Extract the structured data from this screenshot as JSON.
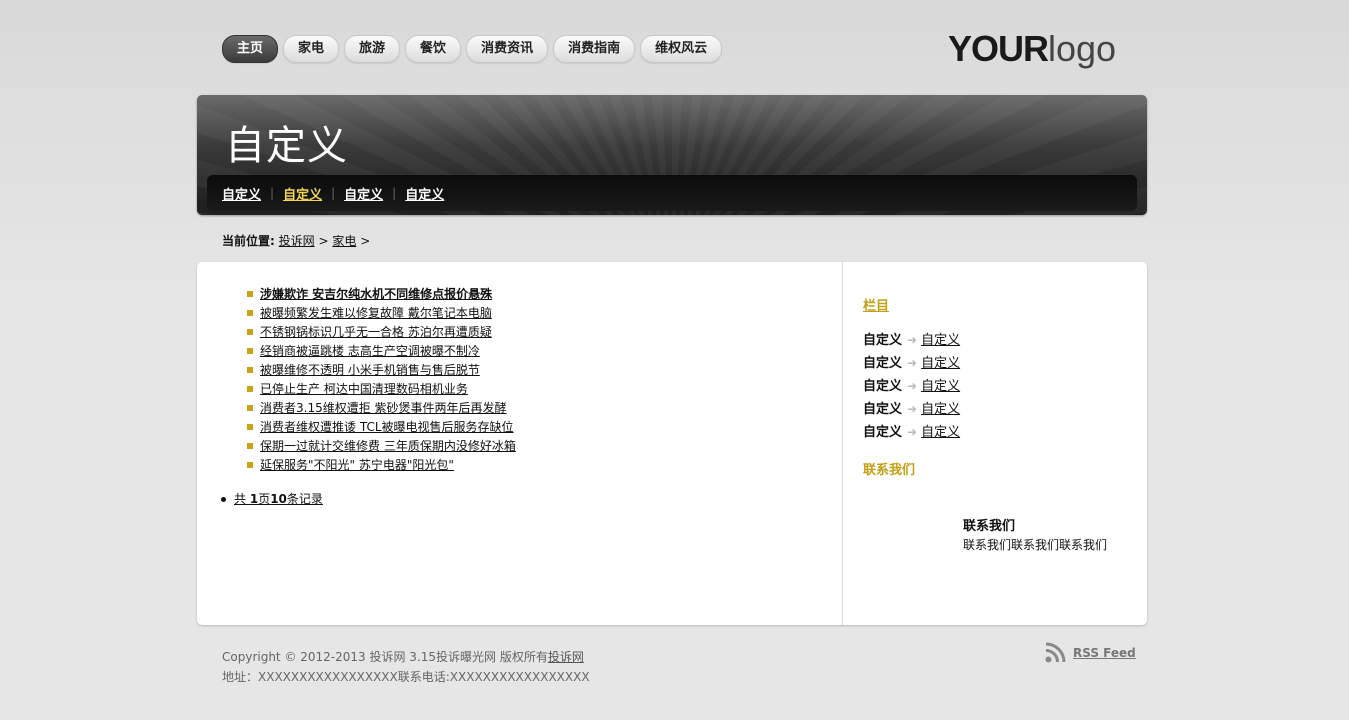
{
  "nav": {
    "tabs": [
      "主页",
      "家电",
      "旅游",
      "餐饮",
      "消费资讯",
      "消费指南",
      "维权风云"
    ],
    "active_index": 0
  },
  "logo": {
    "bold": "YOUR",
    "thin": "logo"
  },
  "banner": {
    "title": "自定义",
    "subnav": [
      "自定义",
      "自定义",
      "自定义",
      "自定义"
    ],
    "subnav_active_index": 1,
    "separator": "|"
  },
  "breadcrumb": {
    "label": "当前位置:",
    "items": [
      "投诉网",
      "家电"
    ],
    "separator": ">"
  },
  "articles": [
    "涉嫌欺诈 安吉尔纯水机不同维修点报价悬殊",
    "被曝频繁发生难以修复故障 戴尔笔记本电脑",
    "不锈钢锅标识几乎无一合格 苏泊尔再遭质疑",
    "经销商被逼跳楼 志高生产空调被曝不制冷",
    "被曝维修不透明 小米手机销售与售后脱节",
    "已停止生产 柯达中国清理数码相机业务",
    "消费者3.15维权遭拒 紫砂煲事件两年后再发酵",
    "消费者维权遭推诿 TCL被曝电视售后服务存缺位",
    "保期一过就计交维修费 三年质保期内没修好冰箱",
    "延保服务\"不阳光\" 苏宁电器\"阳光包\""
  ],
  "pager": {
    "prefix": "共 ",
    "pages": "1",
    "mid": "页",
    "records": "10",
    "suffix": "条记录"
  },
  "sidebar": {
    "column_heading": "栏目",
    "items": [
      {
        "label": "自定义",
        "link": "自定义"
      },
      {
        "label": "自定义",
        "link": "自定义"
      },
      {
        "label": "自定义",
        "link": "自定义"
      },
      {
        "label": "自定义",
        "link": "自定义"
      },
      {
        "label": "自定义",
        "link": "自定义"
      }
    ],
    "arrow_icon": "arrow-right-icon",
    "contact_heading": "联系我们",
    "contact_title": "联系我们",
    "contact_text": "联系我们联系我们联系我们"
  },
  "footer": {
    "copyright_text": "Copyright © 2012-2013 投诉网 3.15投诉曝光网 版权所有",
    "copyright_link": "投诉网",
    "address_line": "地址：XXXXXXXXXXXXXXXXX联系电话:XXXXXXXXXXXXXXXXX",
    "rss_label": "RSS Feed",
    "rss_icon": "rss-icon"
  },
  "colors": {
    "accent_gold": "#c3a018",
    "active_subnav": "#f3d55a",
    "banner_dark": "#202020"
  }
}
